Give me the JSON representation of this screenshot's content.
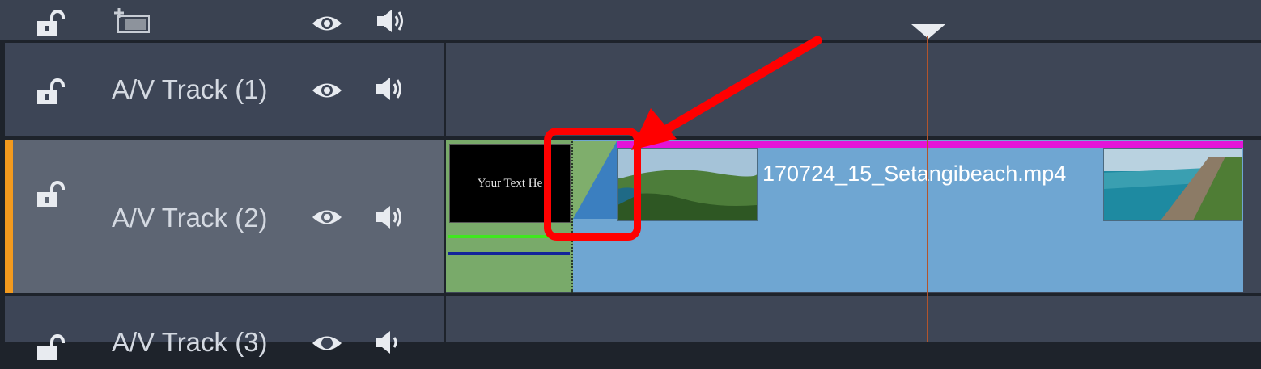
{
  "header": {
    "icons": [
      "lock-open-icon",
      "add-track-icon",
      "eye-icon",
      "speaker-icon"
    ]
  },
  "tracks": [
    {
      "label": "A/V Track (1)",
      "selected": false
    },
    {
      "label": "A/V Track (2)",
      "selected": true
    },
    {
      "label": "A/V Track (3)",
      "selected": false
    }
  ],
  "timeline": {
    "title_clip": {
      "thumbnail_text": "Your Text He"
    },
    "video_clip": {
      "name": "170724_15_Setangibeach.mp4"
    }
  },
  "annotation": {
    "color": "#ff0000"
  },
  "colors": {
    "accent": "#f39a1e",
    "playhead": "#b2542c",
    "video_clip": "#6fa6d2",
    "title_clip": "#79aa6a",
    "transition": "#3b7fc0",
    "magenta_bar": "#e414d8"
  }
}
